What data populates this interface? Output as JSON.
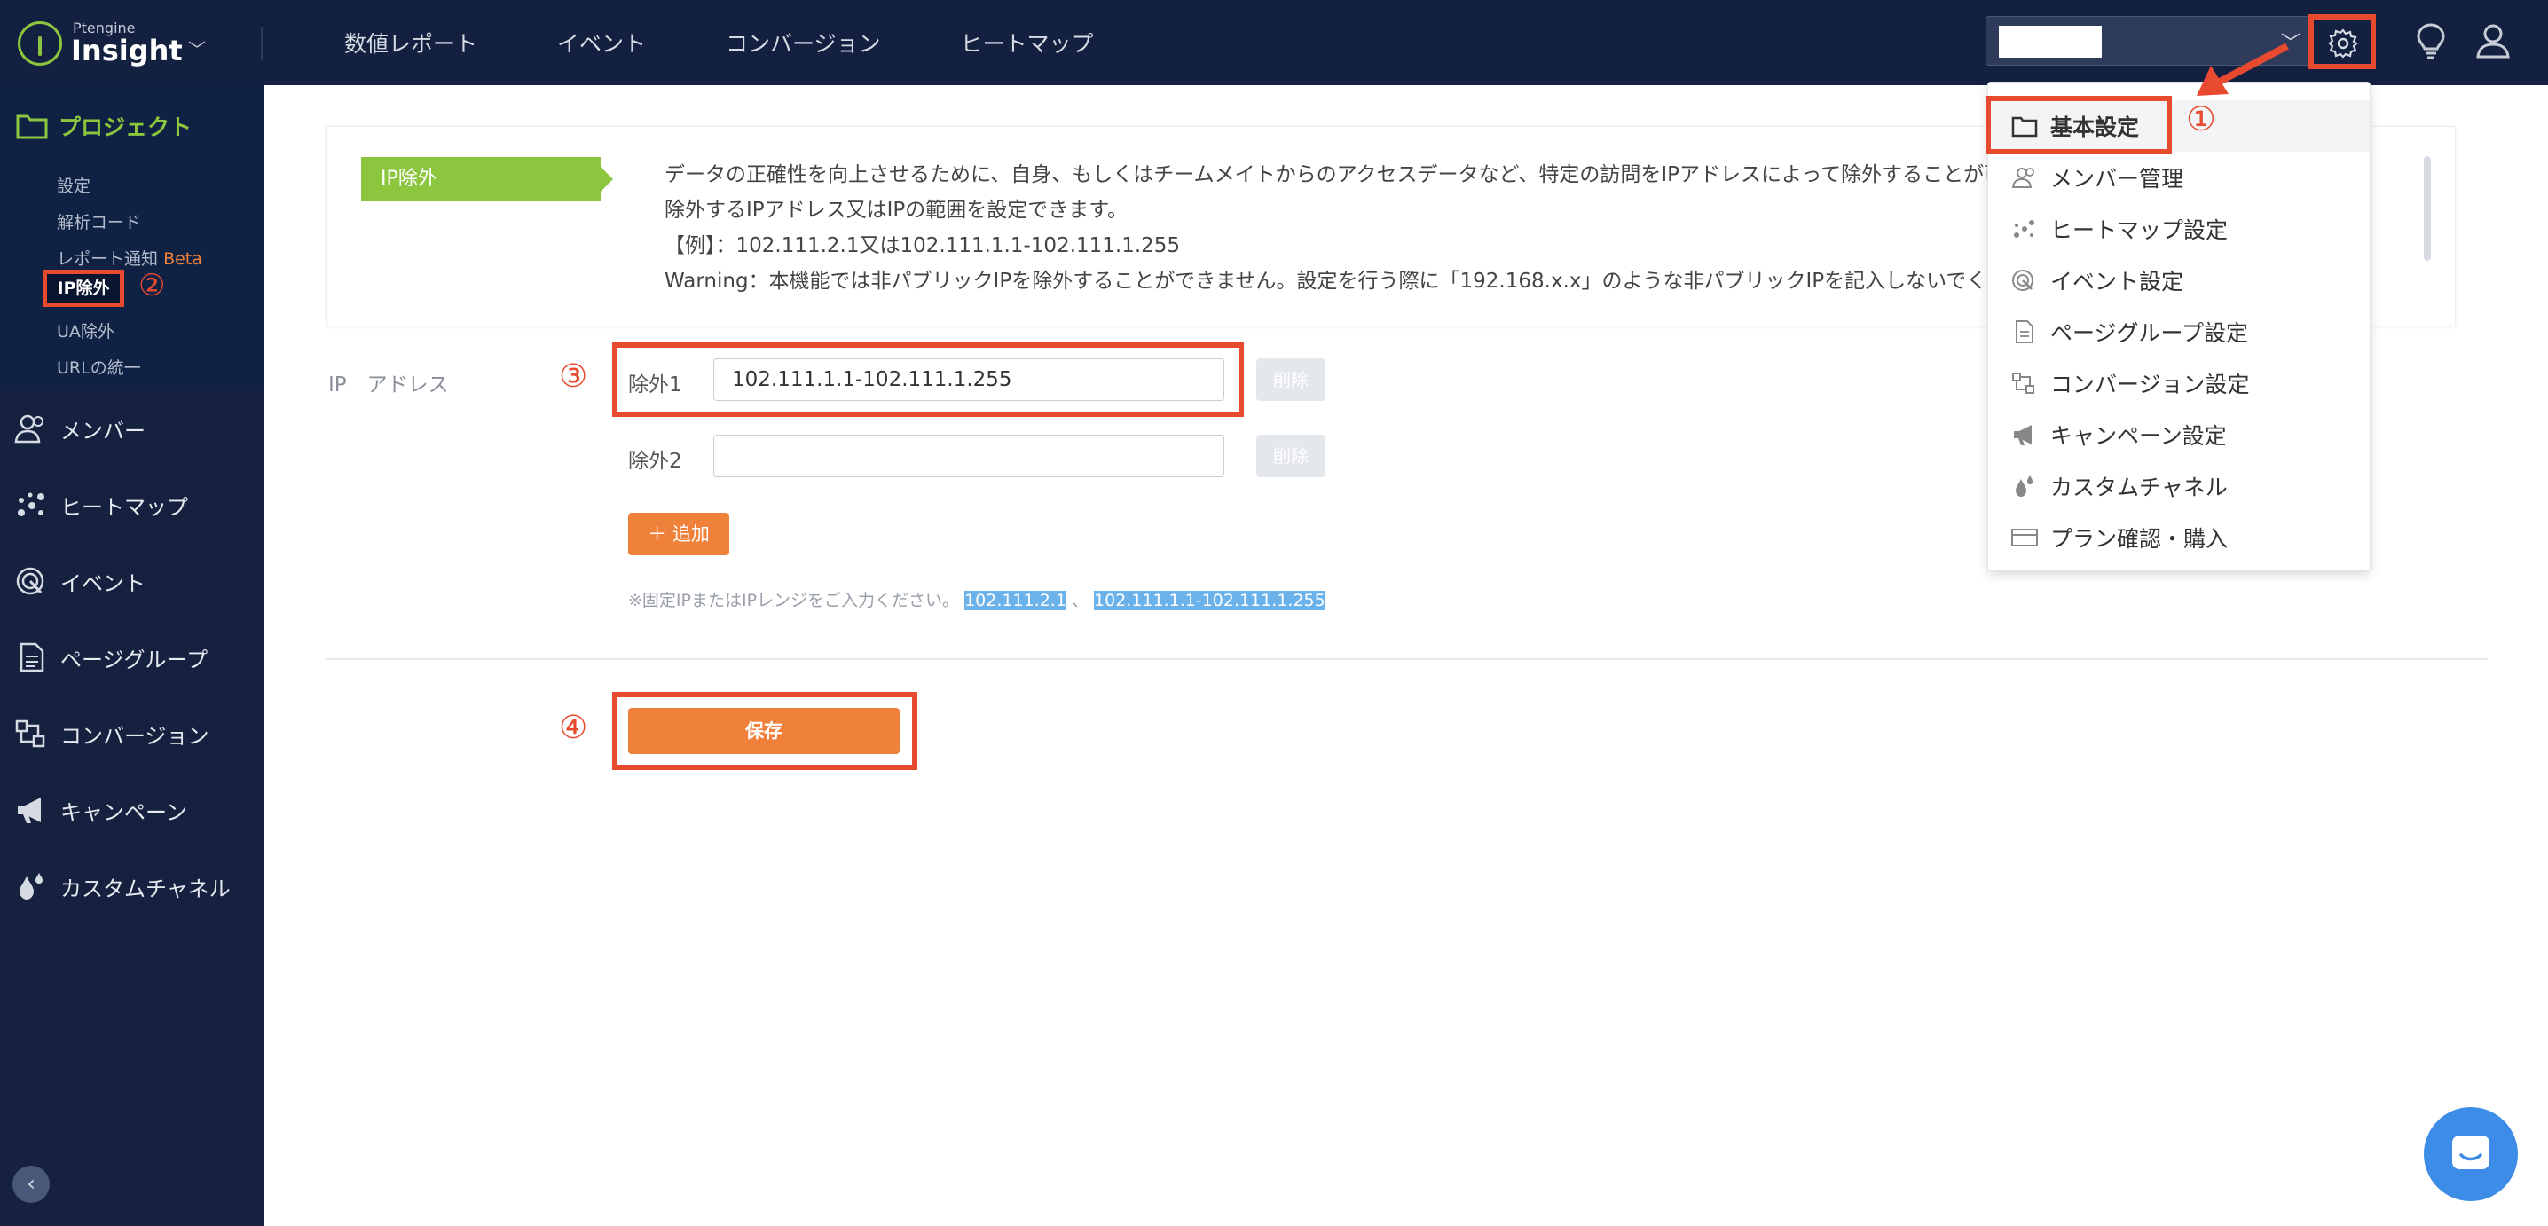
{
  "logo": {
    "small": "Ptengine",
    "big": "Insight"
  },
  "topnav": [
    "数値レポート",
    "イベント",
    "コンバージョン",
    "ヒートマップ"
  ],
  "sidebar": {
    "project_header": "プロジェクト",
    "sub_items": [
      "設定",
      "解析コード",
      "レポート通知",
      "IP除外",
      "UA除外",
      "URLの統一"
    ],
    "beta_label": "Beta",
    "items": [
      "メンバー",
      "ヒートマップ",
      "イベント",
      "ページグループ",
      "コンバージョン",
      "キャンペーン",
      "カスタムチャネル"
    ]
  },
  "info": {
    "tag": "IP除外",
    "lines": [
      "データの正確性を向上させるために、自身、もしくはチームメイトからのアクセスデータなど、特定の訪問をIPアドレスによって除外することが可能",
      "除外するIPアドレス又はIPの範囲を設定できます。",
      "【例】：102.111.2.1又は102.111.1.1-102.111.1.255",
      "Warning：本機能では非パブリックIPを除外することができません。設定を行う際に「192.168.x.x」のような非パブリックIPを記入しないでくださ"
    ]
  },
  "form": {
    "section_label": "IP　アドレス",
    "rows": [
      {
        "label": "除外1",
        "value": "102.111.1.1-102.111.1.255",
        "delete": "削除"
      },
      {
        "label": "除外2",
        "value": "",
        "delete": "削除"
      }
    ],
    "add_button": "追加",
    "hint_prefix": "※固定IPまたはIPレンジをご入力ください。",
    "hint_example1": "102.111.2.1",
    "hint_separator": "、",
    "hint_example2": "102.111.1.1-102.111.1.255",
    "save_button": "保存"
  },
  "dropdown": {
    "items": [
      "基本設定",
      "メンバー管理",
      "ヒートマップ設定",
      "イベント設定",
      "ページグループ設定",
      "コンバージョン設定",
      "キャンペーン設定",
      "カスタムチャネル",
      "プラン確認・購入"
    ]
  },
  "annotations": {
    "n1": "①",
    "n2": "②",
    "n3": "③",
    "n4": "④"
  },
  "colors": {
    "nav_bg": "#13203f",
    "accent_green": "#8cc63f",
    "accent_orange": "#f0813a",
    "annotation_red": "#e84a30"
  }
}
